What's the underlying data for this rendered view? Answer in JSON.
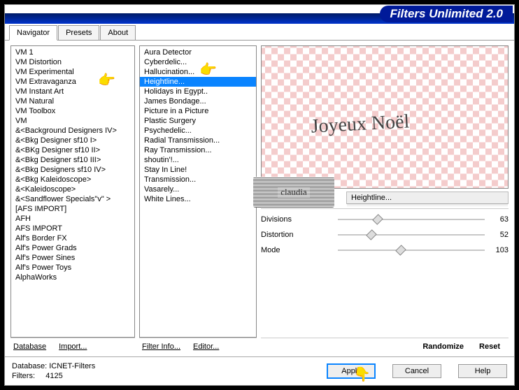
{
  "title": "Filters Unlimited 2.0",
  "tabs": [
    {
      "label": "Navigator",
      "active": true
    },
    {
      "label": "Presets",
      "active": false
    },
    {
      "label": "About",
      "active": false
    }
  ],
  "categories": [
    "VM 1",
    "VM Distortion",
    "VM Experimental",
    "VM Extravaganza",
    "VM Instant Art",
    "VM Natural",
    "VM Toolbox",
    "VM",
    "&<Background Designers IV>",
    "&<Bkg Designer sf10 I>",
    "&<BKg Designer sf10 II>",
    "&<Bkg Designer sf10 III>",
    "&<Bkg Designers sf10 IV>",
    "&<Bkg Kaleidoscope>",
    "&<Kaleidoscope>",
    "&<Sandflower Specials\"v\" >",
    "[AFS IMPORT]",
    "AFH",
    "AFS IMPORT",
    "Alf's Border FX",
    "Alf's Power Grads",
    "Alf's Power Sines",
    "Alf's Power Toys",
    "AlphaWorks"
  ],
  "selected_category_index": 3,
  "filters": [
    "Aura Detector",
    "Cyberdelic...",
    "Hallucination...",
    "Heightline...",
    "Holidays in Egypt..",
    "James Bondage...",
    "Picture in a Picture",
    "Plastic Surgery",
    "Psychedelic...",
    "Radial Transmission...",
    "Ray Transmission...",
    "shoutin'!...",
    "Stay In Line!",
    "Transmission...",
    "Vasarely...",
    "White Lines..."
  ],
  "selected_filter_index": 3,
  "selected_filter_name": "Heightline...",
  "preview_text": "Joyeux Noël",
  "watermark_text": "claudia",
  "params": [
    {
      "label": "Divisions",
      "value": 63,
      "max": 255
    },
    {
      "label": "Distortion",
      "value": 52,
      "max": 255
    },
    {
      "label": "Mode",
      "value": 103,
      "max": 255
    }
  ],
  "buttons_left": {
    "database": "Database",
    "import": "Import...",
    "filter_info": "Filter Info...",
    "editor": "Editor..."
  },
  "buttons_right": {
    "randomize": "Randomize",
    "reset": "Reset"
  },
  "footer": {
    "database_label": "Database:",
    "database_value": "ICNET-Filters",
    "filters_label": "Filters:",
    "filters_value": "4125",
    "apply": "Apply",
    "cancel": "Cancel",
    "help": "Help"
  }
}
